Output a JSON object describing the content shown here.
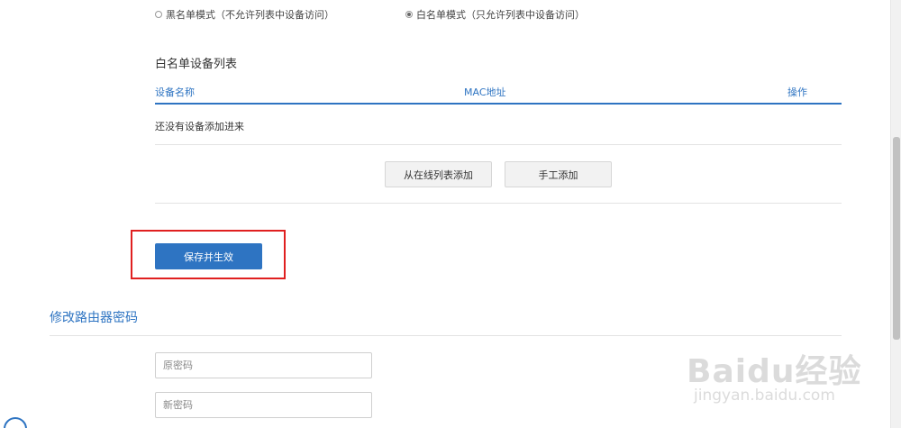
{
  "filter_mode": {
    "blacklist_label": "黑名单模式（不允许列表中设备访问）",
    "whitelist_label": "白名单模式（只允许列表中设备访问）",
    "selected": "whitelist"
  },
  "whitelist": {
    "title": "白名单设备列表",
    "columns": [
      "设备名称",
      "MAC地址",
      "操作"
    ],
    "empty_text": "还没有设备添加进来",
    "add_from_online_label": "从在线列表添加",
    "add_manual_label": "手工添加"
  },
  "save_label": "保存并生效",
  "password": {
    "title": "修改路由器密码",
    "old_placeholder": "原密码",
    "new_placeholder": "新密码"
  },
  "watermark": {
    "main": "Baidu经验",
    "sub": "jingyan.baidu.com"
  },
  "colors": {
    "accent": "#2e74c2",
    "highlight": "#e02020"
  }
}
